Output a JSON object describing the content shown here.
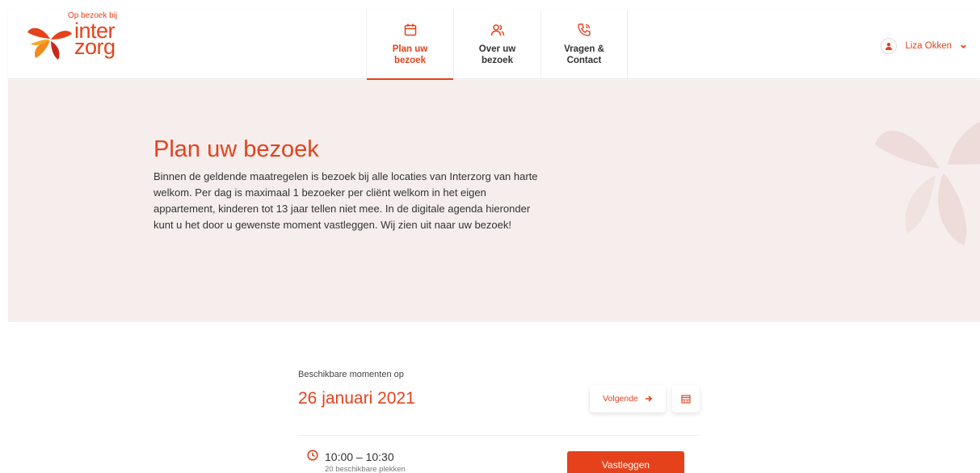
{
  "logo": {
    "tagline": "Op bezoek bij",
    "word1": "inter",
    "word2": "zorg"
  },
  "nav": [
    {
      "label": "Plan uw\nbezoek",
      "icon": "calendar-icon",
      "active": true
    },
    {
      "label": "Over uw\nbezoek",
      "icon": "users-icon",
      "active": false
    },
    {
      "label": "Vragen &\nContact",
      "icon": "phone-icon",
      "active": false
    }
  ],
  "user": {
    "name": "Liza Okken",
    "icon": "user-icon"
  },
  "hero": {
    "title": "Plan uw bezoek",
    "text": "Binnen de geldende maatregelen is bezoek bij alle locaties van Interzorg van harte welkom. Per dag is maximaal 1 bezoeker per cliënt welkom in het eigen appartement, kinderen tot 13 jaar tellen niet mee. In de digitale agenda hieronder kunt u het door u gewenste moment vastleggen. Wij zien uit naar uw bezoek!"
  },
  "availability": {
    "subtitle": "Beschikbare momenten op",
    "date": "26 januari 2021",
    "next_label": "Volgende",
    "slot": {
      "time": "10:00 – 10:30",
      "places": "20 beschikbare plekken",
      "confirm_label": "Vastleggen"
    }
  },
  "colors": {
    "accent": "#e5421c",
    "hero_bg": "#f5eeed"
  }
}
